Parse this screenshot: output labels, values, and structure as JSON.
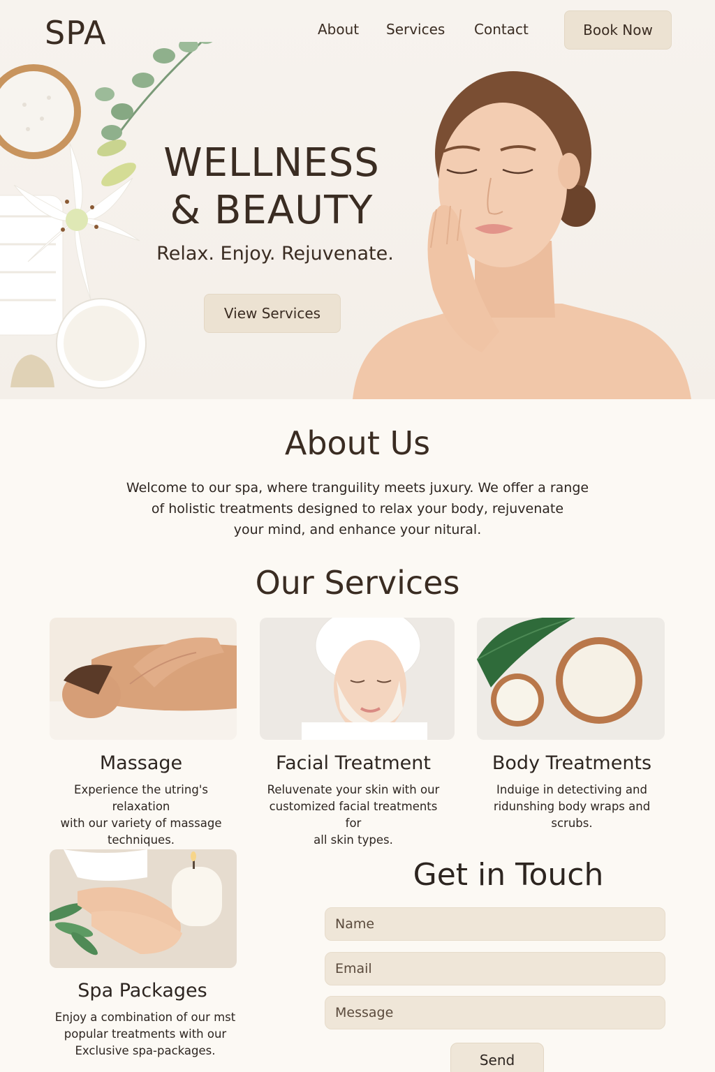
{
  "header": {
    "logo": "SPA",
    "nav": [
      {
        "label": "About"
      },
      {
        "label": "Services"
      },
      {
        "label": "Contact"
      }
    ],
    "cta_label": "Book Now"
  },
  "hero": {
    "title_line1": "WELLNESS",
    "title_line2": "& BEAUTY",
    "subtitle": "Relax. Enjoy. Rejuvenate.",
    "button_label": "View Services"
  },
  "about": {
    "title": "About Us",
    "line1": "Welcome to our spa, where tranguility meets juxury. We offer a range",
    "line2": "of holistic treatments designed to relax your body, rejuvenate",
    "line3": "your mind, and enhance your nitural."
  },
  "services": {
    "title": "Our Services",
    "items": [
      {
        "title": "Massage",
        "desc_lines": [
          "Experience the utring's relaxation",
          "with our variety of massage",
          "techniques."
        ]
      },
      {
        "title": "Facial Treatment",
        "desc_lines": [
          "Reluvenate your skin with our",
          "customized facial treatments for",
          "all skin types."
        ]
      },
      {
        "title": "Body Treatments",
        "desc_lines": [
          "Induige in detectiving and",
          "ridunshing body wraps and",
          "scrubs."
        ]
      },
      {
        "title": "Spa Packages",
        "desc_lines": [
          "Enjoy a combination of our mst",
          "popular treatments with our",
          "Exclusive spa-packages."
        ]
      }
    ]
  },
  "contact": {
    "title": "Get in Touch",
    "name_placeholder": "Name",
    "email_placeholder": "Email",
    "message_placeholder": "Message",
    "send_label": "Send"
  },
  "colors": {
    "background": "#fcf9f4",
    "button": "#ece2d2",
    "text": "#3a2c22"
  }
}
